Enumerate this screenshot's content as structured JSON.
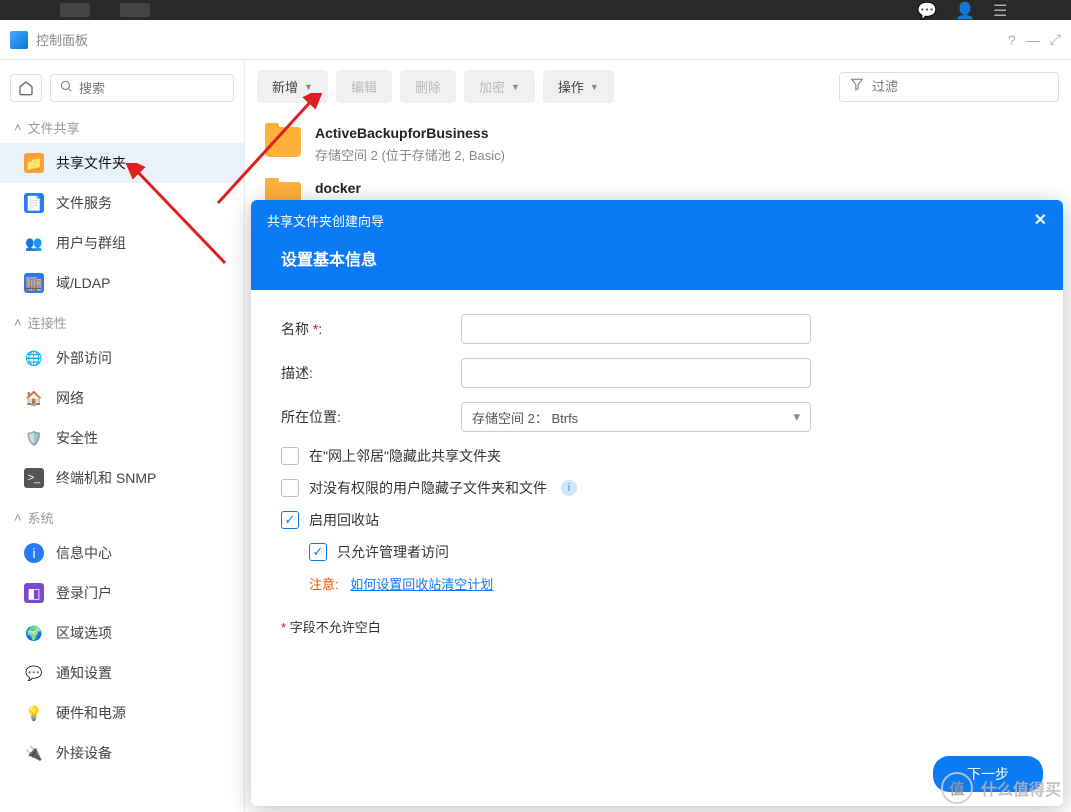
{
  "window": {
    "title": "控制面板",
    "help": "?",
    "min": "—",
    "max": "⤢"
  },
  "search": {
    "placeholder": "搜索"
  },
  "sections": {
    "file_share": "文件共享",
    "connectivity": "连接性",
    "system": "系统"
  },
  "nav": {
    "shared_folder": "共享文件夹",
    "file_service": "文件服务",
    "user_group": "用户与群组",
    "domain_ldap": "域/LDAP",
    "external_access": "外部访问",
    "network": "网络",
    "security": "安全性",
    "terminal_snmp": "终端机和 SNMP",
    "info_center": "信息中心",
    "login_portal": "登录门户",
    "region_option": "区域选项",
    "notification": "通知设置",
    "hardware_power": "硬件和电源",
    "external_device": "外接设备"
  },
  "toolbar": {
    "add": "新增",
    "edit": "编辑",
    "delete": "删除",
    "encrypt": "加密",
    "action": "操作",
    "filter": "过滤"
  },
  "folders": [
    {
      "name": "ActiveBackupforBusiness",
      "sub": "存储空间 2 (位于存储池 2, Basic)"
    },
    {
      "name": "docker",
      "sub": ""
    }
  ],
  "modal": {
    "wizard_title": "共享文件夹创建向导",
    "subtitle": "设置基本信息",
    "labels": {
      "name": "名称",
      "desc": "描述:",
      "location": "所在位置:"
    },
    "location_value": "存储空间 2：  Btrfs",
    "opt_hide_network": "在\"网上邻居\"隐藏此共享文件夹",
    "opt_hide_noauth": "对没有权限的用户隐藏子文件夹和文件",
    "opt_recycle": "启用回收站",
    "opt_admin_only": "只允许管理者访问",
    "note_prefix": "注意:",
    "note_link": "如何设置回收站清空计划",
    "footnote_star": "*",
    "footnote_text": "字段不允许空白",
    "next": "下一步"
  },
  "watermark": {
    "logo": "值",
    "text": "什么值得买"
  }
}
